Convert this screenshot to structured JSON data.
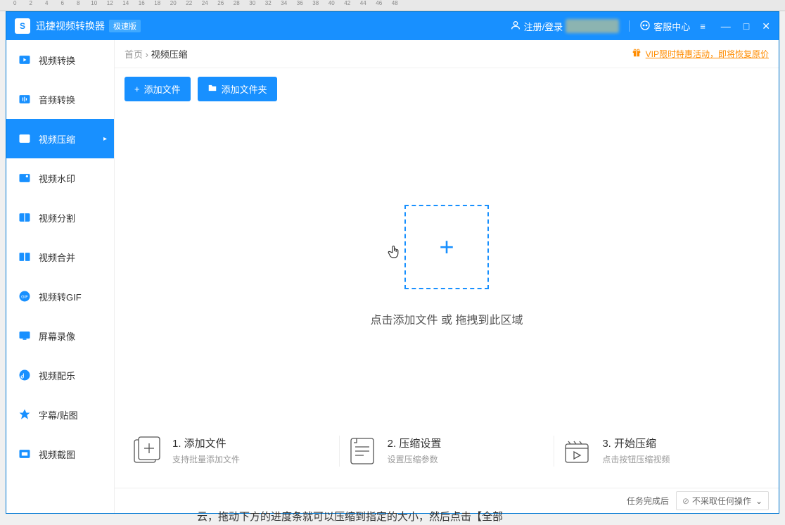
{
  "ruler": {
    "marks": [
      0,
      2,
      4,
      6,
      8,
      10,
      12,
      14,
      16,
      18,
      20,
      22,
      24,
      26,
      28,
      30,
      32,
      34,
      36,
      38,
      40,
      42,
      44,
      46,
      48
    ]
  },
  "titlebar": {
    "app_title": "迅捷视频转换器",
    "badge": "极速版",
    "register_login": "注册/登录",
    "customer_service": "客服中心",
    "menu_icon": "≡"
  },
  "sidebar": {
    "items": [
      {
        "label": "视频转换",
        "icon": "video-convert"
      },
      {
        "label": "音频转换",
        "icon": "audio-convert"
      },
      {
        "label": "视频压缩",
        "icon": "video-compress"
      },
      {
        "label": "视频水印",
        "icon": "video-watermark"
      },
      {
        "label": "视频分割",
        "icon": "video-split"
      },
      {
        "label": "视频合并",
        "icon": "video-merge"
      },
      {
        "label": "视频转GIF",
        "icon": "video-gif"
      },
      {
        "label": "屏幕录像",
        "icon": "screen-record"
      },
      {
        "label": "视频配乐",
        "icon": "video-music"
      },
      {
        "label": "字幕/贴图",
        "icon": "subtitle"
      },
      {
        "label": "视频截图",
        "icon": "video-screenshot"
      }
    ],
    "active_index": 2
  },
  "breadcrumb": {
    "home": "首页",
    "separator": "›",
    "current": "视频压缩"
  },
  "promo": {
    "text": "VIP限时特惠活动，即将恢复原价"
  },
  "toolbar": {
    "add_file": "添加文件",
    "add_folder": "添加文件夹"
  },
  "dropzone": {
    "hint": "点击添加文件 或 拖拽到此区域"
  },
  "steps": [
    {
      "title": "1. 添加文件",
      "desc": "支持批量添加文件"
    },
    {
      "title": "2. 压缩设置",
      "desc": "设置压缩参数"
    },
    {
      "title": "3. 开始压缩",
      "desc": "点击按钮压缩视频"
    }
  ],
  "footer": {
    "after_label": "任务完成后",
    "action_select": "不采取任何操作"
  },
  "truncated": "云，拖动下方的进度条就可以压缩到指定的大小，然后点击【全部"
}
